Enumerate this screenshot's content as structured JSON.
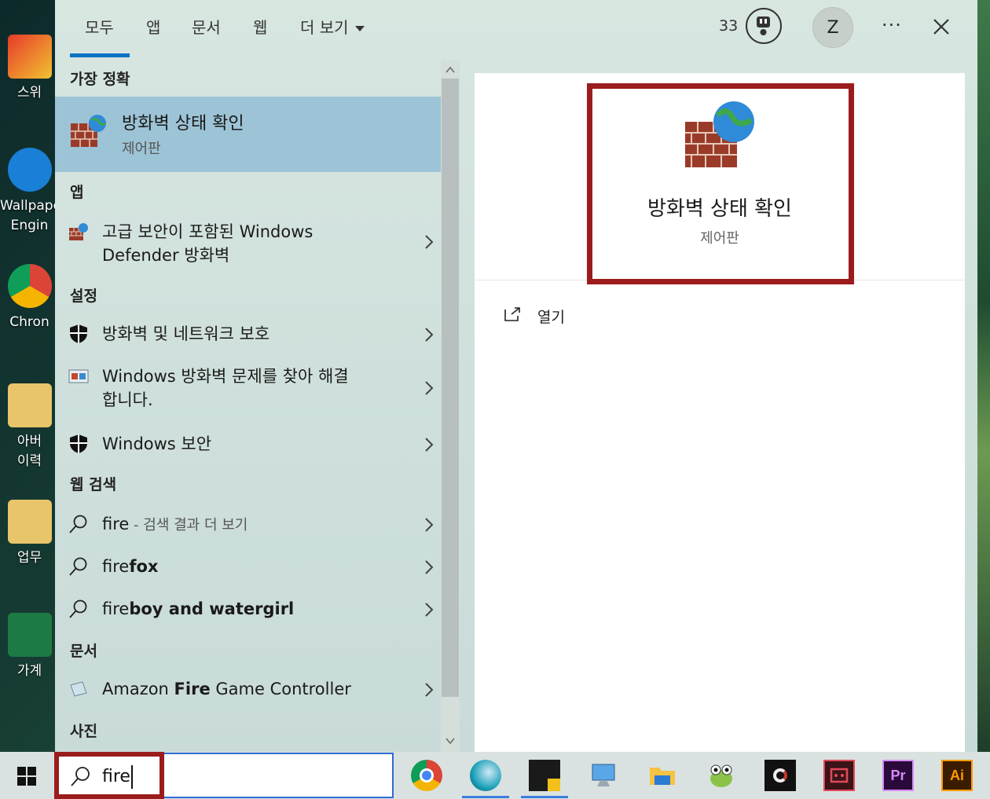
{
  "desktop": {
    "icons": [
      {
        "label": "스위",
        "color": "#d6402a"
      },
      {
        "label": "Wallpaper",
        "label2": "Engin",
        "color": "#1a7fd6"
      },
      {
        "label": "Chron",
        "color": "#e0e0e0"
      },
      {
        "label": "아버",
        "label2": "이력",
        "color": "#e8c56a"
      },
      {
        "label": "업무",
        "color": "#e8c56a"
      },
      {
        "label": "가계",
        "color": "#1e7a44"
      }
    ]
  },
  "header": {
    "tabs": [
      "모두",
      "앱",
      "문서",
      "웹",
      "더 보기"
    ],
    "points": "33",
    "avatar_letter": "Z",
    "more": "···"
  },
  "results": {
    "best_match": {
      "heading": "가장 정확",
      "title": "방화벽 상태 확인",
      "subtitle": "제어판"
    },
    "apps_heading": "앱",
    "app": {
      "line1": "고급 보안이 포함된 Windows",
      "line2": "Defender 방화벽"
    },
    "settings_heading": "설정",
    "settings": [
      {
        "text": "방화벽 및 네트워크 보호"
      },
      {
        "line1": "Windows 방화벽 문제를 찾아 해결",
        "line2": "합니다."
      },
      {
        "text": "Windows 보안"
      }
    ],
    "web_heading": "웹 검색",
    "web": [
      {
        "prefix": "fire",
        "sep": " - ",
        "suffix": "검색 결과 더 보기"
      },
      {
        "prefix": "fire",
        "bold": "fox"
      },
      {
        "prefix": "fire",
        "bold": "boy and watergirl"
      }
    ],
    "docs_heading": "문서",
    "doc": {
      "prefix": "Amazon ",
      "bold": "Fire",
      "suffix": " Game Controller"
    },
    "photos_heading": "사진"
  },
  "preview": {
    "title": "방화벽 상태 확인",
    "subtitle": "제어판",
    "open_label": "열기"
  },
  "taskbar": {
    "search_query": "fire"
  }
}
